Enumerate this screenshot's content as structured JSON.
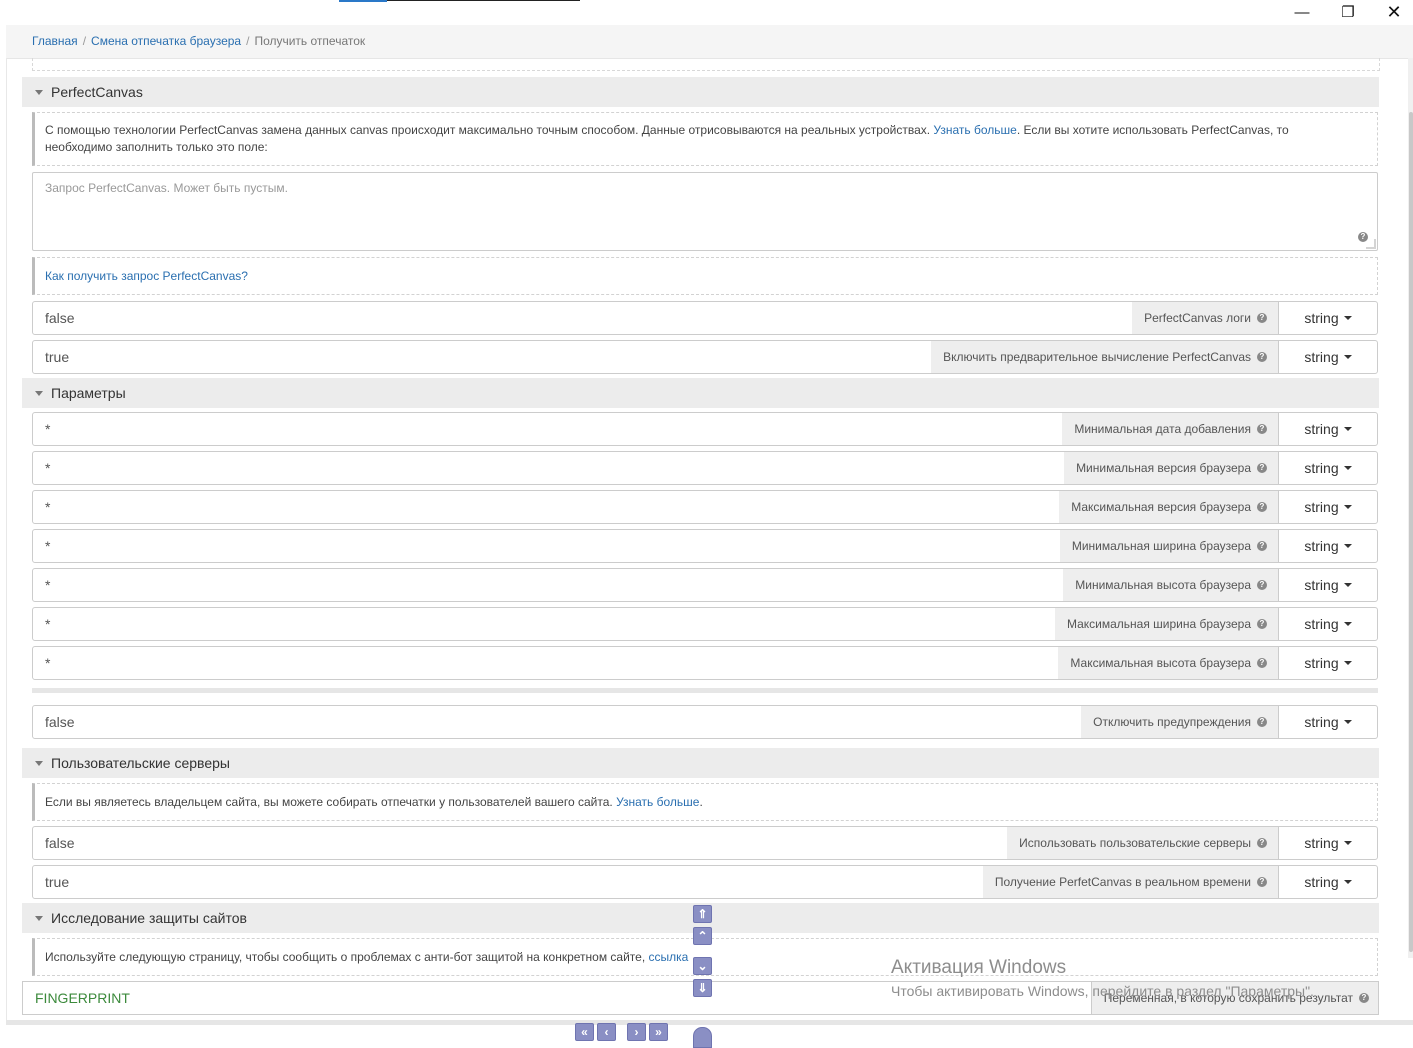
{
  "window": {
    "minimize_icon": "minimize-icon",
    "maximize_icon": "restore-icon",
    "close_icon": "close-icon",
    "minimize_glyph": "—",
    "maximize_glyph": "❐",
    "close_glyph": "✕"
  },
  "breadcrumb": {
    "items": [
      "Главная",
      "Смена отпечатка браузера",
      "Получить отпечаток"
    ],
    "separator": "/"
  },
  "perfect_canvas": {
    "title": "PerfectCanvas",
    "info_text": "С помощью технологии PerfectCanvas замена данных canvas происходит максимально точным способом. Данные отрисовываются на реальных устройствах.",
    "info_link": "Узнать больше",
    "info_text_after": ". Если вы хотите использовать PerfectCanvas, то необходимо заполнить только это поле:",
    "textarea_placeholder": "Запрос PerfectCanvas. Может быть пустым.",
    "how_to_link": "Как получить запрос PerfectCanvas?",
    "fields": [
      {
        "value": "false",
        "label": "PerfectCanvas логи",
        "type": "string"
      },
      {
        "value": "true",
        "label": "Включить предварительное вычисление PerfectCanvas",
        "type": "string"
      }
    ]
  },
  "parameters": {
    "title": "Параметры",
    "fields": [
      {
        "value": "*",
        "label": "Минимальная дата добавления",
        "type": "string"
      },
      {
        "value": "*",
        "label": "Минимальная версия браузера",
        "type": "string"
      },
      {
        "value": "*",
        "label": "Максимальная версия браузера",
        "type": "string"
      },
      {
        "value": "*",
        "label": "Минимальная ширина браузера",
        "type": "string"
      },
      {
        "value": "*",
        "label": "Минимальная высота браузера",
        "type": "string"
      },
      {
        "value": "*",
        "label": "Максимальная ширина браузера",
        "type": "string"
      },
      {
        "value": "*",
        "label": "Максимальная высота браузера",
        "type": "string"
      }
    ],
    "warnings_field": {
      "value": "false",
      "label": "Отключить предупреждения",
      "type": "string"
    }
  },
  "custom_servers": {
    "title": "Пользовательские серверы",
    "info_text": "Если вы являетесь владельцем сайта, вы можете собирать отпечатки у пользователей вашего сайта.",
    "info_link": "Узнать больше",
    "info_text_after": ".",
    "fields": [
      {
        "value": "false",
        "label": "Использовать пользовательские серверы",
        "type": "string"
      },
      {
        "value": "true",
        "label": "Получение PerfetCanvas в реальном времени",
        "type": "string"
      }
    ]
  },
  "site_protection": {
    "title": "Исследование защиты сайтов",
    "info_text": "Используйте следующую страницу, чтобы сообщить о проблемах с анти-бот защитой на конкретном сайте,",
    "info_link": "ссылка"
  },
  "result": {
    "value": "FINGERPRINT",
    "label": "Переменная, в которую сохранить результат"
  },
  "activation": {
    "title": "Активация Windows",
    "subtitle": "Чтобы активировать Windows, перейдите в раздел \"Параметры\"."
  },
  "nav": {
    "scroll_top_icon": "double-chevron-up-icon",
    "scroll_up_icon": "chevron-up-icon",
    "scroll_down_icon": "chevron-down-icon",
    "scroll_bottom_icon": "double-chevron-down-icon",
    "first_icon": "double-chevron-left-icon",
    "prev_icon": "chevron-left-icon",
    "next_icon": "chevron-right-icon",
    "last_icon": "double-chevron-right-icon",
    "help_glyph": "?",
    "glyph_top": "⇑",
    "glyph_up": "⌃",
    "glyph_down": "⌄",
    "glyph_bottom": "⇓",
    "glyph_first": "«",
    "glyph_prev": "‹",
    "glyph_next": "›",
    "glyph_last": "»"
  }
}
